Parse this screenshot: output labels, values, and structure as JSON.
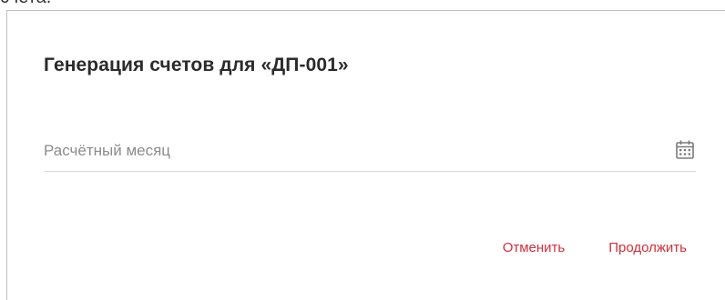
{
  "background_text": "счета.",
  "dialog": {
    "title": "Генерация счетов для «ДП-001»",
    "billing_month": {
      "placeholder": "Расчётный месяц",
      "value": "",
      "icon": "calendar-icon"
    },
    "buttons": {
      "cancel": "Отменить",
      "continue": "Продолжить"
    }
  },
  "colors": {
    "accent": "#d32f3a",
    "title": "#2b2b2b",
    "placeholder": "#8c8c8c",
    "divider": "#d9d9d9"
  }
}
